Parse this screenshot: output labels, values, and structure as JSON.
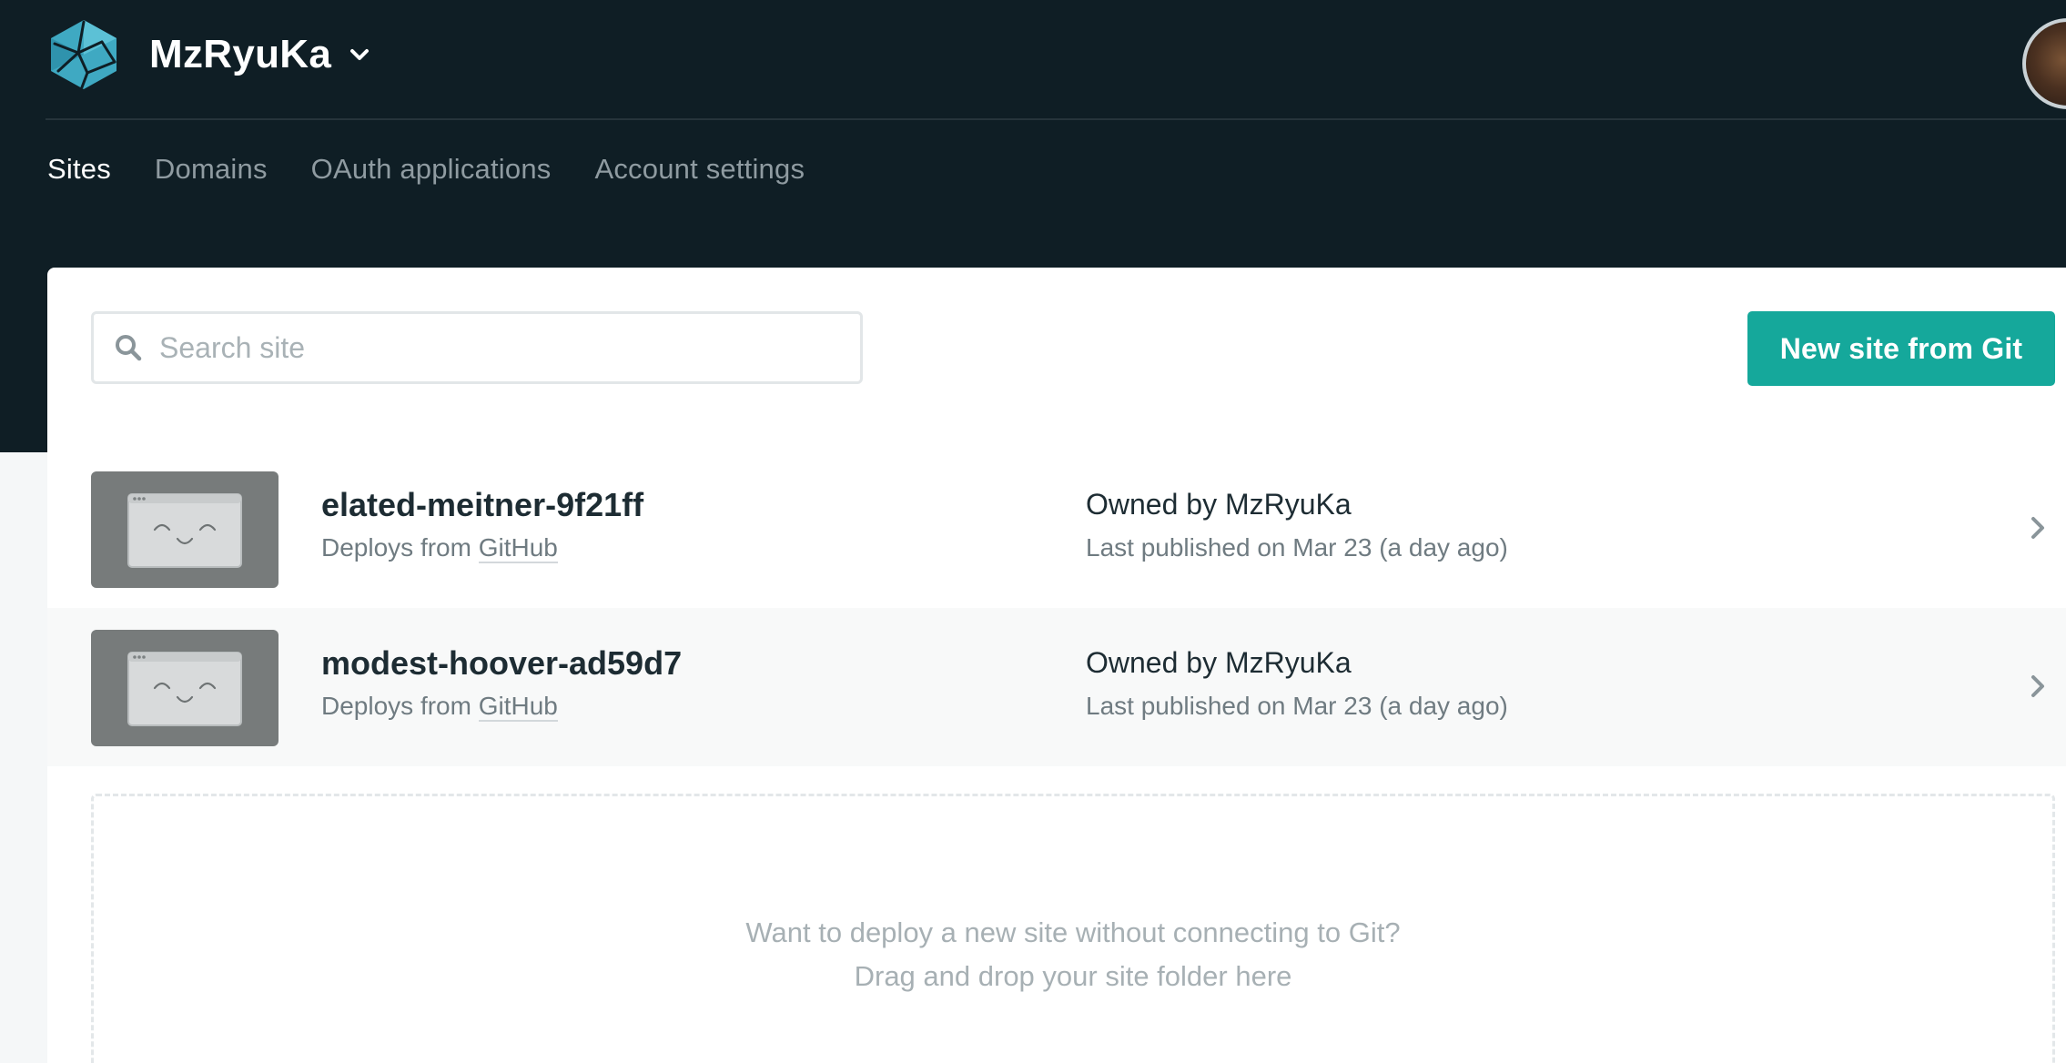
{
  "header": {
    "team_name": "MzRyuKa",
    "logo_icon": "netlify-logo-icon",
    "dropdown_icon": "chevron-down-icon",
    "avatar_icon": "user-avatar"
  },
  "nav": {
    "tabs": [
      {
        "label": "Sites",
        "active": true
      },
      {
        "label": "Domains",
        "active": false
      },
      {
        "label": "OAuth applications",
        "active": false
      },
      {
        "label": "Account settings",
        "active": false
      }
    ]
  },
  "search": {
    "placeholder": "Search site",
    "value": "",
    "icon": "search-icon"
  },
  "toolbar": {
    "new_site_label": "New site from Git"
  },
  "sites": [
    {
      "name": "elated-meitner-9f21ff",
      "deploys_prefix": "Deploys from ",
      "deploys_source": "GitHub",
      "owner_prefix": "Owned by ",
      "owner": "MzRyuKa",
      "published": "Last published on Mar 23 (a day ago)"
    },
    {
      "name": "modest-hoover-ad59d7",
      "deploys_prefix": "Deploys from ",
      "deploys_source": "GitHub",
      "owner_prefix": "Owned by ",
      "owner": "MzRyuKa",
      "published": "Last published on Mar 23 (a day ago)"
    }
  ],
  "dropzone": {
    "line1": "Want to deploy a new site without connecting to Git?",
    "line2": "Drag and drop your site folder here"
  },
  "colors": {
    "header_bg": "#0f1e25",
    "accent": "#15a89b",
    "page_bg": "#f5f7f8"
  }
}
